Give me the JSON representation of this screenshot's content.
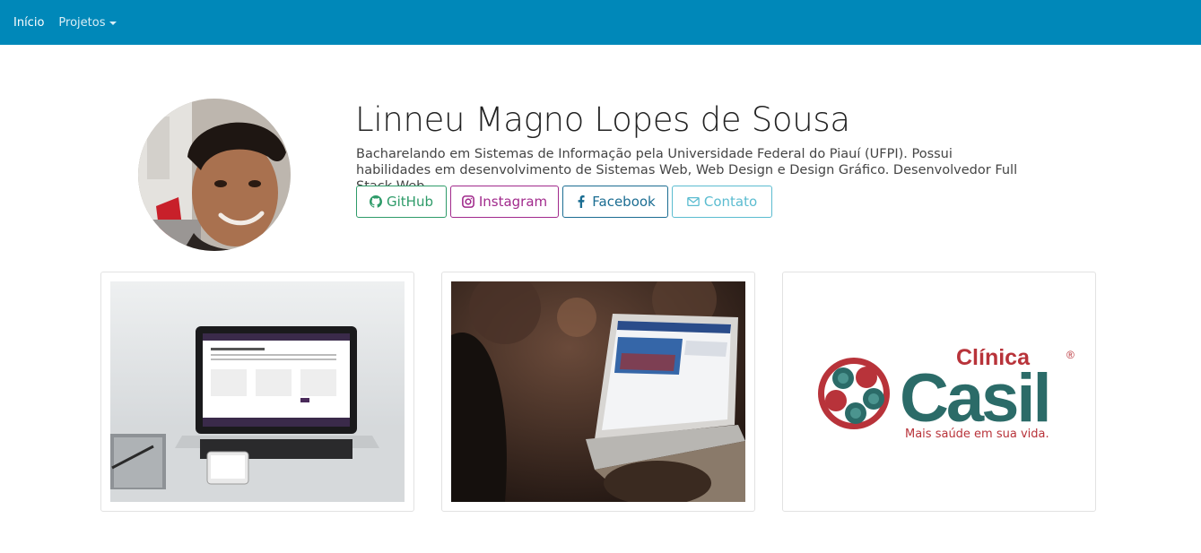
{
  "nav": {
    "home_label": "Início",
    "projects_label": "Projetos",
    "bg_color": "#0088b9"
  },
  "profile": {
    "name": "Linneu Magno Lopes de Sousa",
    "bio": "Bacharelando em Sistemas de Informação pela Universidade Federal do Piauí (UFPI). Possui habilidades em desenvolvimento de Sistemas Web, Web Design e Design Gráfico. Desenvolvedor Full Stack Web."
  },
  "buttons": {
    "github": {
      "label": "GitHub",
      "icon": "github-icon",
      "color": "#2e9b69"
    },
    "instagram": {
      "label": "Instagram",
      "icon": "instagram-icon",
      "color": "#a12a8c"
    },
    "facebook": {
      "label": "Facebook",
      "icon": "facebook-icon",
      "color": "#1b6d92"
    },
    "contato": {
      "label": "Contato",
      "icon": "envelope-icon",
      "color": "#5bbcd0"
    }
  },
  "projects": [
    {
      "image": "laptop-on-desk-screenshot"
    },
    {
      "image": "laptop-in-classroom-photo"
    },
    {
      "image": "clinica-casil-logo",
      "logo": {
        "top": "Clínica",
        "main": "Casil",
        "tagline": "Mais saúde em sua vida."
      }
    }
  ]
}
